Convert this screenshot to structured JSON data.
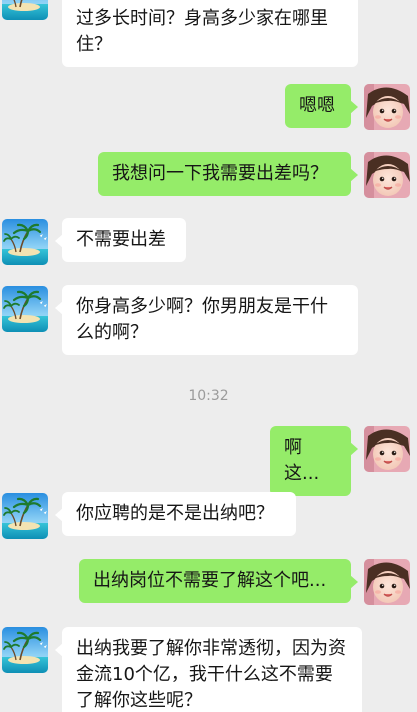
{
  "colors": {
    "background": "#ededed",
    "incoming_bubble": "#ffffff",
    "outgoing_bubble": "#95ec69",
    "text": "#161616",
    "timestamp": "#9b9b9b"
  },
  "avatars": {
    "contact": "beach-island-palm-trees-icon",
    "me": "child-face-photo-icon"
  },
  "messages": [
    {
      "side": "in",
      "text": "待遇福利的吗，多不多大了？做过多长时间？身高多少家在哪里住？"
    },
    {
      "side": "out",
      "text": "嗯嗯"
    },
    {
      "side": "out",
      "text": "我想问一下我需要出差吗？"
    },
    {
      "side": "in",
      "text": "不需要出差"
    },
    {
      "side": "in",
      "text": "你身高多少啊？你男朋友是干什么的啊？"
    },
    {
      "side": "out",
      "text": "啊这..."
    },
    {
      "side": "in",
      "text": "你应聘的是不是出纳吧？"
    },
    {
      "side": "out",
      "text": "出纳岗位不需要了解这个吧..."
    },
    {
      "side": "in",
      "text": "出纳我要了解你非常透彻，因为资金流10个亿，我干什么这不需要了解你这些呢？"
    }
  ],
  "timestamp": "10:32"
}
